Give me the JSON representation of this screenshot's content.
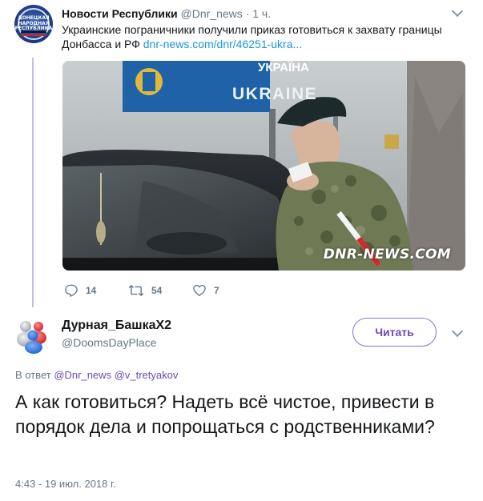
{
  "parent_tweet": {
    "author_name": "Новости Республики",
    "handle": "@Dnr_news",
    "separator": "·",
    "time": "1 ч.",
    "text_line1": "Украинские пограничники получили приказ готовиться к захвату границы",
    "text_line2": "Донбасса и РФ",
    "link": "dnr-news.com/dnr/46251-ukra...",
    "avatar_logo_text": "ДОНЕЦКАЯ НАРОДНАЯ РЕСПУБЛИКА",
    "image": {
      "sign_top": "УКРАЇНА",
      "sign_bottom": "UKRAINE",
      "watermark": "DNR-NEWS.COM"
    },
    "stats": {
      "replies": "14",
      "retweets": "54",
      "likes": "7"
    }
  },
  "reply_tweet": {
    "author_name": "Дурная_БашкаХ2",
    "handle": "@DoomsDayPlace",
    "follow_label": "Читать",
    "reply_prefix": "В ответ",
    "mention1": "@Dnr_news",
    "mention2": "@v_tretyakov",
    "text": "А как готовиться? Надеть всё чистое, привести в порядок дела и попрощаться с родственниками?",
    "timestamp": "4:43 - 19 июл. 2018 г."
  },
  "colors": {
    "accent": "#6d4ab8",
    "link": "#1b95e0",
    "muted": "#657786",
    "thread_line": "#c8bde0"
  }
}
